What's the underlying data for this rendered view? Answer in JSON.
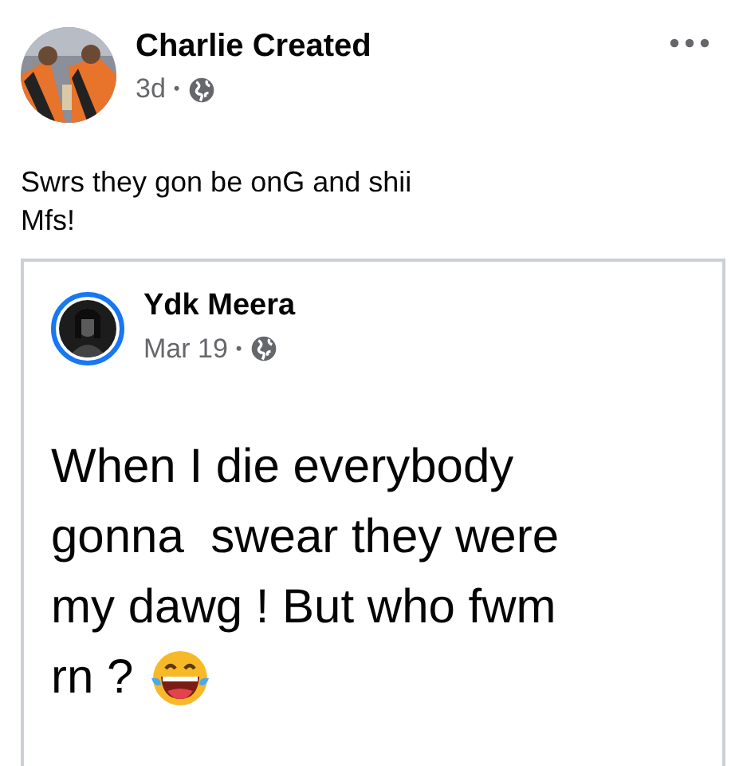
{
  "post": {
    "author": "Charlie Created",
    "time": "3d",
    "separator": "•",
    "text_lines": [
      "Swrs they gon be onG and shii",
      "Mfs!"
    ]
  },
  "shared_post": {
    "author": "Ydk Meera",
    "time": "Mar 19",
    "separator": "•",
    "text_lines": [
      "When I die everybody",
      "gonna  swear they were",
      "my dawg ! But who fwm",
      "rn ?"
    ]
  }
}
